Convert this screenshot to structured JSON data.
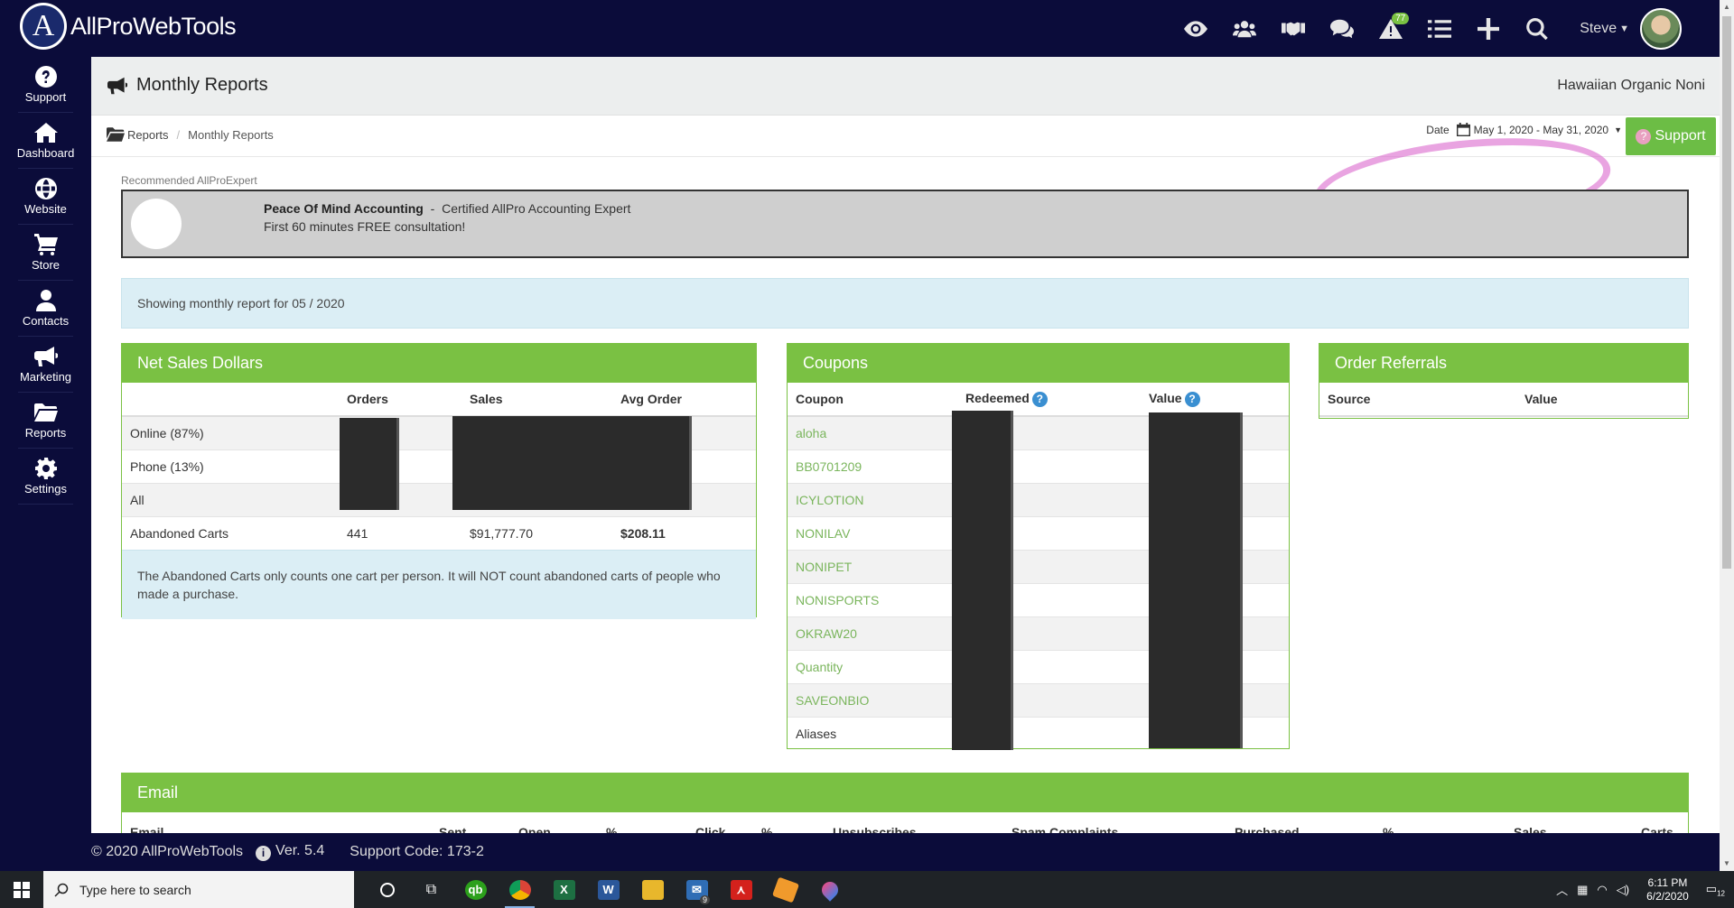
{
  "app": {
    "logo_letter": "A",
    "name": "AllProWebTools"
  },
  "topnav": {
    "icons": [
      "eye-icon",
      "users-icon",
      "handshake-icon",
      "chat-icon",
      "alert-icon",
      "tasks-icon",
      "plus-icon",
      "search-icon"
    ],
    "alert_count": "77",
    "user_name": "Steve"
  },
  "sidebar": {
    "items": [
      {
        "label": "Support",
        "icon": "question-circle-icon"
      },
      {
        "label": "Dashboard",
        "icon": "home-icon"
      },
      {
        "label": "Website",
        "icon": "globe-icon"
      },
      {
        "label": "Store",
        "icon": "cart-icon"
      },
      {
        "label": "Contacts",
        "icon": "person-icon"
      },
      {
        "label": "Marketing",
        "icon": "megaphone-icon"
      },
      {
        "label": "Reports",
        "icon": "folder-icon"
      },
      {
        "label": "Settings",
        "icon": "gear-icon"
      }
    ]
  },
  "page": {
    "title": "Monthly Reports",
    "company": "Hawaiian Organic Noni",
    "breadcrumb": {
      "root": "Reports",
      "separator": "/",
      "current": "Monthly Reports"
    },
    "date_label": "Date",
    "date_range": "May 1, 2020 - May 31, 2020",
    "support_label": "Support"
  },
  "recommended": {
    "label": "Recommended AllProExpert",
    "name": "Peace Of Mind Accounting",
    "dash": "-",
    "tagline": "Certified AllPro Accounting Expert",
    "offer": "First 60 minutes FREE consultation!"
  },
  "info": {
    "text": "Showing monthly report for 05 / 2020"
  },
  "net_sales": {
    "title": "Net Sales Dollars",
    "headers": [
      "",
      "Orders",
      "Sales",
      "Avg Order"
    ],
    "rows": [
      {
        "label": "Online (87%)",
        "orders": "",
        "sales": "",
        "avg": ""
      },
      {
        "label": "Phone (13%)",
        "orders": "",
        "sales": "",
        "avg": ""
      },
      {
        "label": "All",
        "orders": "",
        "sales": "",
        "avg": ""
      },
      {
        "label": "Abandoned Carts",
        "orders": "441",
        "sales": "$91,777.70",
        "avg": "$208.11"
      }
    ],
    "note": "The Abandoned Carts only counts one cart per person. It will NOT count abandoned carts of people who made a purchase."
  },
  "coupons": {
    "title": "Coupons",
    "headers": [
      "Coupon",
      "Redeemed",
      "Value"
    ],
    "help_glyph": "?",
    "rows": [
      "aloha",
      "BB0701209",
      "ICYLOTION",
      "NONILAV",
      "NONIPET",
      "NONISPORTS",
      "OKRAW20",
      "Quantity",
      "SAVEONBIO",
      "Aliases"
    ]
  },
  "order_referrals": {
    "title": "Order Referrals",
    "headers": [
      "Source",
      "Value"
    ]
  },
  "email": {
    "title": "Email",
    "headers": [
      "Email",
      "Sent",
      "Open",
      "%",
      "Click",
      "%",
      "Unsubscribes",
      "Spam Complaints",
      "Purchased",
      "%",
      "Sales",
      "Carts"
    ]
  },
  "footer": {
    "copyright": "© 2020 AllProWebTools",
    "info_glyph": "i",
    "version": "Ver. 5.4",
    "support_code": "Support Code: 173-2"
  },
  "taskbar": {
    "search_placeholder": "Type here to search",
    "mail_badge": "9",
    "time": "6:11 PM",
    "date": "6/2/2020",
    "notification_count": "12"
  },
  "colors": {
    "navy": "#0b0c3a",
    "green": "#7ac143",
    "link_green": "#7ab55c",
    "info_blue": "#dbeef5",
    "help_blue": "#3a8fd1"
  }
}
